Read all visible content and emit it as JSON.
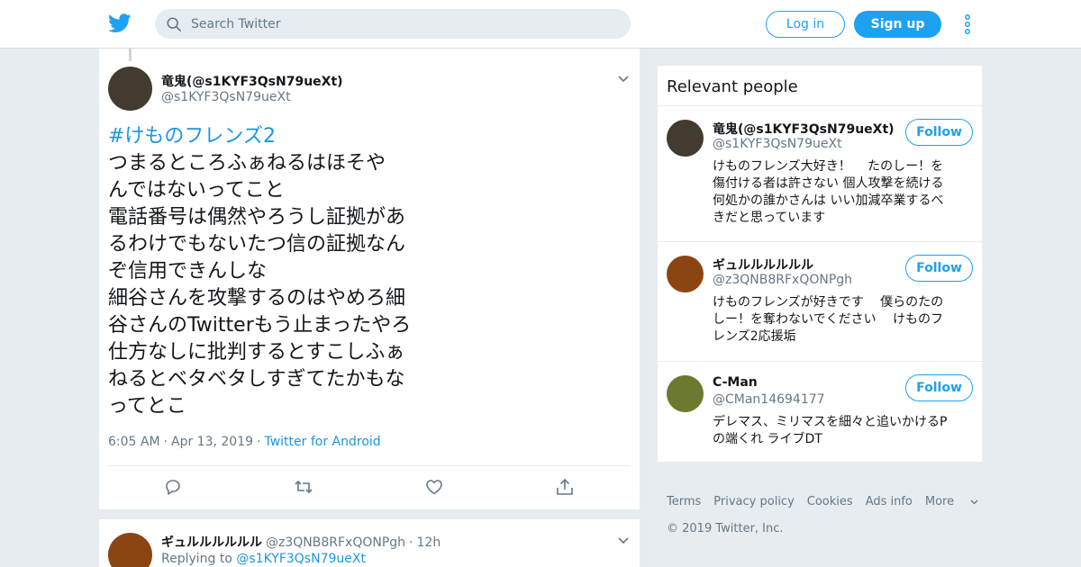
{
  "nav": {
    "search_placeholder": "Search Twitter",
    "login_label": "Log in",
    "signup_label": "Sign up",
    "icons": [
      "twitter-bird-icon",
      "search-icon",
      "more-vertical-icon"
    ]
  },
  "tweet": {
    "author_name": "竜鬼(@s1KYF3QsN79ueXt)",
    "author_handle": "@s1KYF3QsN79ueXt",
    "avatar_color": "#433a30",
    "hashtag": "#けものフレンズ2",
    "text_lines": [
      "つまるところふぁねるはほそや",
      "んではないってこと",
      "電話番号は偶然やろうし証拠があ",
      "るわけでもないたつ信の証拠なん",
      "ぞ信用できんしな",
      "細谷さんを攻撃するのはやめろ細",
      "谷さんのTwitterもう止まったやろ",
      "仕方なしに批判するとすこしふぁ",
      "ねるとベタベタしすぎてたかもな",
      "ってとこ"
    ],
    "time": "6:05 AM",
    "date": "Apr 13, 2019",
    "source": "Twitter for Android",
    "actions": [
      "reply-icon",
      "retweet-icon",
      "like-icon",
      "share-icon"
    ]
  },
  "reply": {
    "author_name": "ギュルルルルルル",
    "author_handle": "@z3QNB8RFxQONPgh",
    "age": "12h",
    "replying_label": "Replying to",
    "replying_to": "@s1KYF3QsN79ueXt",
    "avatar_color": "#8b4513"
  },
  "relevant_people": {
    "title": "Relevant people",
    "follow_label": "Follow",
    "people": [
      {
        "name": "竜鬼(@s1KYF3QsN79ueXt)",
        "handle": "@s1KYF3QsN79ueXt",
        "avatar_color": "#433a30",
        "bio_lines": [
          "けものフレンズ大好き！　 たのしー！を",
          "傷付ける者は許さない 個人攻撃を続ける",
          "何処かの誰かさんは いい加減卒業するべ",
          "きだと思っています"
        ]
      },
      {
        "name": "ギュルルルルルル",
        "handle": "@z3QNB8RFxQONPgh",
        "avatar_color": "#8b4513",
        "bio_lines": [
          "けものフレンズが好きです　 僕らのたの",
          "しー！を奪わないでください　 けものフ",
          "レンズ2応援垢"
        ]
      },
      {
        "name": "C-Man",
        "handle": "@CMan14694177",
        "avatar_color": "#6b7a2e",
        "bio_lines": [
          "デレマス、ミリマスを細々と追いかけるP",
          "の端くれ ライブDT"
        ]
      }
    ]
  },
  "footer": {
    "links": [
      "Terms",
      "Privacy policy",
      "Cookies",
      "Ads info"
    ],
    "more_label": "More",
    "copyright": "© 2019 Twitter, Inc."
  },
  "colors": {
    "brand": "#1da1f2",
    "link": "#1b95e0",
    "background": "#e6ecf0",
    "secondary_text": "#657786"
  }
}
